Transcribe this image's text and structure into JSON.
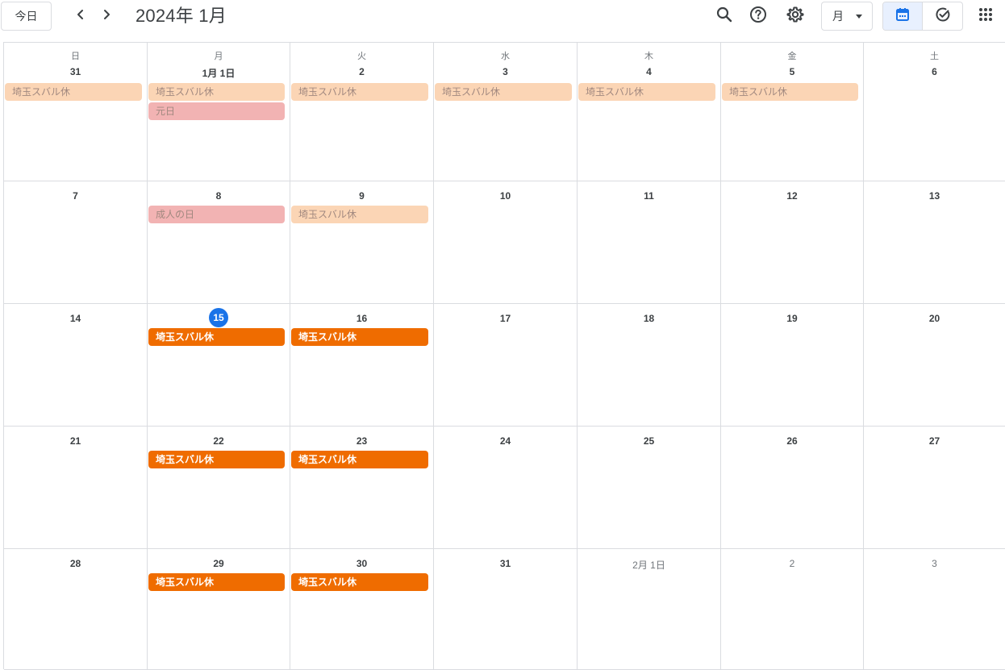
{
  "toolbar": {
    "today_label": "今日",
    "month_title": "2024年 1月",
    "view_label": "月"
  },
  "weekdays": [
    "日",
    "月",
    "火",
    "水",
    "木",
    "金",
    "土"
  ],
  "weeks": [
    [
      {
        "label": "31",
        "other": false
      },
      {
        "label": "1月 1日",
        "other": false
      },
      {
        "label": "2",
        "other": false
      },
      {
        "label": "3",
        "other": false
      },
      {
        "label": "4",
        "other": false
      },
      {
        "label": "5",
        "other": false
      },
      {
        "label": "6",
        "other": false
      }
    ],
    [
      {
        "label": "7"
      },
      {
        "label": "8"
      },
      {
        "label": "9"
      },
      {
        "label": "10"
      },
      {
        "label": "11"
      },
      {
        "label": "12"
      },
      {
        "label": "13"
      }
    ],
    [
      {
        "label": "14"
      },
      {
        "label": "15",
        "today": true
      },
      {
        "label": "16"
      },
      {
        "label": "17"
      },
      {
        "label": "18"
      },
      {
        "label": "19"
      },
      {
        "label": "20"
      }
    ],
    [
      {
        "label": "21"
      },
      {
        "label": "22"
      },
      {
        "label": "23"
      },
      {
        "label": "24"
      },
      {
        "label": "25"
      },
      {
        "label": "26"
      },
      {
        "label": "27"
      }
    ],
    [
      {
        "label": "28"
      },
      {
        "label": "29"
      },
      {
        "label": "30"
      },
      {
        "label": "31"
      },
      {
        "label": "2月 1日",
        "other": true
      },
      {
        "label": "2",
        "other": true
      },
      {
        "label": "3",
        "other": true
      }
    ]
  ],
  "events": [
    {
      "week": 0,
      "day": 0,
      "slot": 0,
      "title": "埼玉スバル休",
      "kind": "past"
    },
    {
      "week": 0,
      "day": 1,
      "slot": 0,
      "title": "埼玉スバル休",
      "kind": "past"
    },
    {
      "week": 0,
      "day": 1,
      "slot": 1,
      "title": "元日",
      "kind": "holiday"
    },
    {
      "week": 0,
      "day": 2,
      "slot": 0,
      "title": "埼玉スバル休",
      "kind": "past"
    },
    {
      "week": 0,
      "day": 3,
      "slot": 0,
      "title": "埼玉スバル休",
      "kind": "past"
    },
    {
      "week": 0,
      "day": 4,
      "slot": 0,
      "title": "埼玉スバル休",
      "kind": "past"
    },
    {
      "week": 0,
      "day": 5,
      "slot": 0,
      "title": "埼玉スバル休",
      "kind": "past"
    },
    {
      "week": 1,
      "day": 1,
      "slot": 0,
      "title": "成人の日",
      "kind": "holiday"
    },
    {
      "week": 1,
      "day": 2,
      "slot": 0,
      "title": "埼玉スバル休",
      "kind": "past"
    },
    {
      "week": 2,
      "day": 1,
      "slot": 0,
      "title": "埼玉スバル休",
      "kind": "future"
    },
    {
      "week": 2,
      "day": 2,
      "slot": 0,
      "title": "埼玉スバル休",
      "kind": "future"
    },
    {
      "week": 3,
      "day": 1,
      "slot": 0,
      "title": "埼玉スバル休",
      "kind": "future"
    },
    {
      "week": 3,
      "day": 2,
      "slot": 0,
      "title": "埼玉スバル休",
      "kind": "future"
    },
    {
      "week": 4,
      "day": 1,
      "slot": 0,
      "title": "埼玉スバル休",
      "kind": "future"
    },
    {
      "week": 4,
      "day": 2,
      "slot": 0,
      "title": "埼玉スバル休",
      "kind": "future"
    }
  ],
  "colors": {
    "accent": "#1a73e8",
    "event_future": "#ef6c00",
    "event_past": "#fbd5b5",
    "event_holiday": "#f2b3b3",
    "grid_line": "#dadce0"
  }
}
